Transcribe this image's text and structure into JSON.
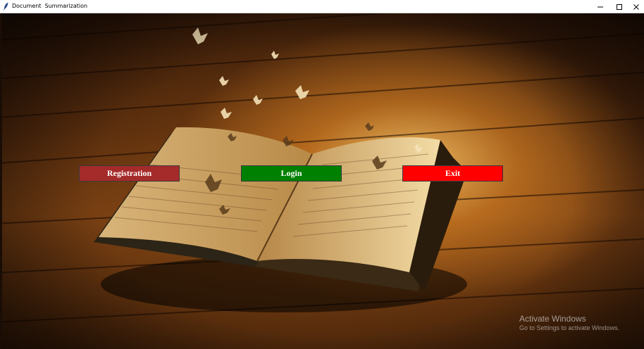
{
  "window": {
    "title": "Document  Summarization",
    "minimize_icon": "minimize-icon",
    "maximize_icon": "maximize-icon",
    "close_icon": "close-icon"
  },
  "background": {
    "image": "open-book-with-butterflies-on-wooden-floor"
  },
  "buttons": {
    "registration": {
      "label": "Registration",
      "color": "#a52a2a"
    },
    "login": {
      "label": "Login",
      "color": "#008000"
    },
    "exit": {
      "label": "Exit",
      "color": "#ff0000"
    }
  },
  "watermark": {
    "title": "Activate Windows",
    "subtitle": "Go to Settings to activate Windows."
  }
}
